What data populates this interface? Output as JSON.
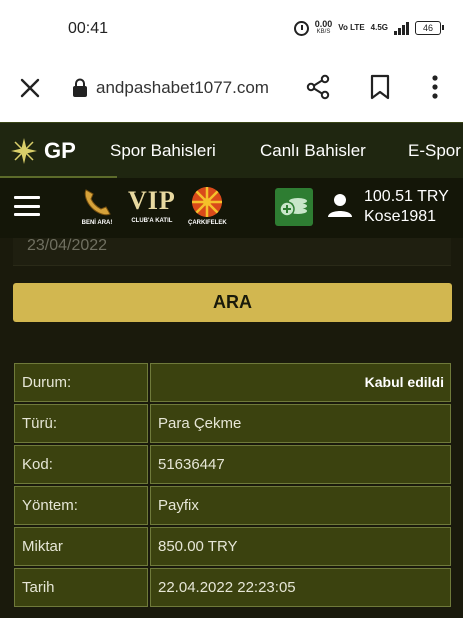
{
  "status_bar": {
    "time": "00:41",
    "net_speed": "0.00",
    "net_unit": "KB/S",
    "volte": "Vo LTE",
    "network": "4.5G",
    "battery": "46"
  },
  "browser": {
    "url": "andpashabet1077.com"
  },
  "site": {
    "logo_text": "GP",
    "nav": [
      "Spor Bahisleri",
      "Canlı Bahisler",
      "E-Spor"
    ],
    "promos": [
      "BENİ ARA!",
      "CLUB'A KATIL",
      "ÇARKIFELEK"
    ],
    "promo_vip": "VIP",
    "user": {
      "balance": "100.51 TRY",
      "username": "Kose1981"
    }
  },
  "filter": {
    "date_value": "23/04/2022",
    "search_label": "ARA"
  },
  "transaction": [
    {
      "label": "Durum:",
      "value": "Kabul edildi"
    },
    {
      "label": "Türü:",
      "value": "Para Çekme"
    },
    {
      "label": "Kod:",
      "value": "51636447"
    },
    {
      "label": "Yöntem:",
      "value": "Payfix"
    },
    {
      "label": "Miktar",
      "value": "850.00 TRY"
    },
    {
      "label": "Tarih",
      "value": "22.04.2022 22:23:05"
    }
  ]
}
